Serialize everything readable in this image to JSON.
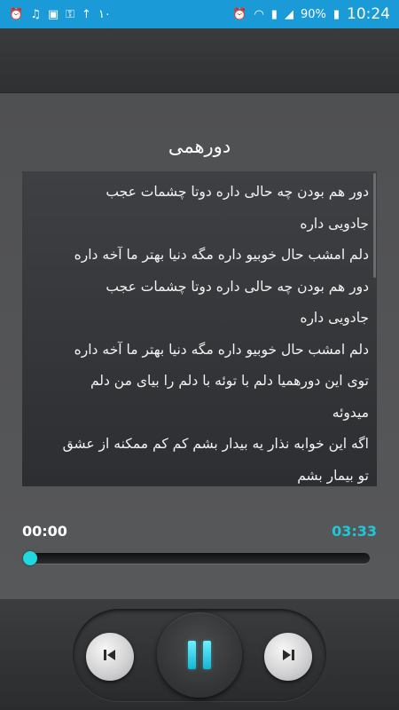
{
  "status_bar": {
    "left_icons": [
      "alarm-small-icon",
      "music-note-icon",
      "image-icon",
      "key-icon",
      "signal-1-icon"
    ],
    "left_text": "١٠",
    "battery_percent": "90%",
    "time": "10:24"
  },
  "song": {
    "title": "دورهمی",
    "lyrics": [
      "دور هم بودن چه حالی داره دوتا چشمات عجب",
      "جادویی داره",
      "دلم امشب حال خوبیو داره مگه دنیا بهتر ما آخه داره",
      "دور هم بودن چه حالی داره دوتا چشمات عجب",
      "جادویی داره",
      "دلم امشب حال خوبیو داره مگه دنیا بهتر ما آخه داره",
      "توی این دورهمیا دلم با توئه با دلم را بیای من دلم",
      "میدوئه",
      "اگه این خوابه نذار یه بیدار بشم کم کم ممکنه از عشق",
      "تو بیمار بشم"
    ]
  },
  "player": {
    "elapsed": "00:00",
    "duration": "03:33",
    "progress": 0.01,
    "accent_color": "#1fc7d9",
    "state": "playing"
  }
}
